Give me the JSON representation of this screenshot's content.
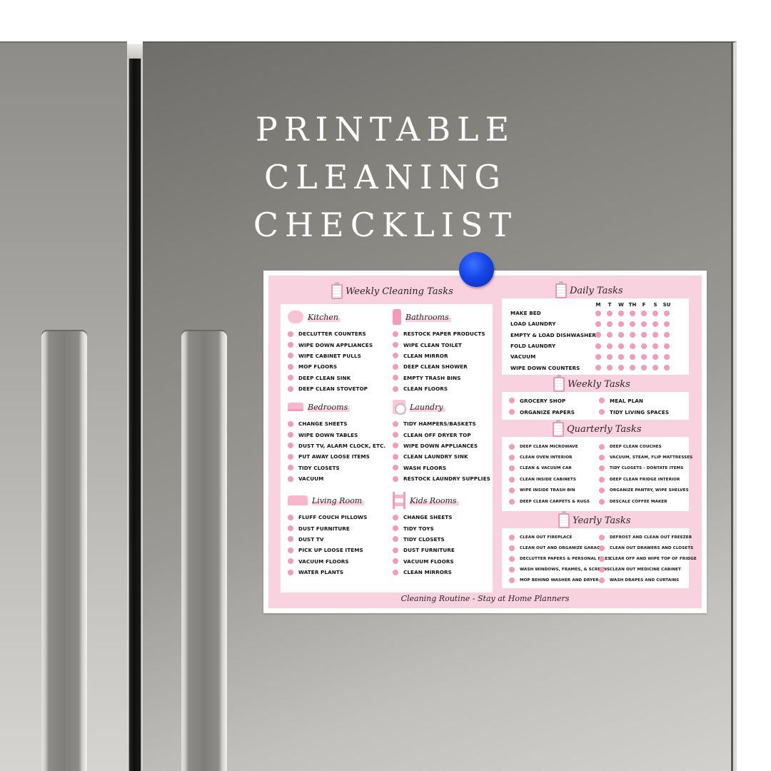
{
  "headline": {
    "lines": [
      "PRINTABLE",
      "CLEANING",
      "CHECKLIST"
    ]
  },
  "checklist": {
    "weekly_cleaning": {
      "title": "Weekly Cleaning Tasks",
      "icon": "clipboard-icon",
      "categories": [
        {
          "name": "Kitchen",
          "icon": "sponge-icon",
          "tasks": [
            "DECLUTTER COUNTERS",
            "WIPE DOWN APPLIANCES",
            "WIPE CABINET PULLS",
            "MOP FLOORS",
            "DEEP CLEAN SINK",
            "DEEP CLEAN STOVETOP"
          ]
        },
        {
          "name": "Bathrooms",
          "icon": "spray-bottle-icon",
          "tasks": [
            "RESTOCK PAPER PRODUCTS",
            "WIPE CLEAN TOILET",
            "CLEAN MIRROR",
            "DEEP CLEAN SHOWER",
            "EMPTY TRASH BINS",
            "CLEAN FLOORS"
          ]
        },
        {
          "name": "Bedrooms",
          "icon": "bed-icon",
          "tasks": [
            "CHANGE SHEETS",
            "WIPE DOWN TABLES",
            "DUST TV, ALARM CLOCK, ETC.",
            "PUT AWAY LOOSE ITEMS",
            "TIDY CLOSETS",
            "VACUUM"
          ]
        },
        {
          "name": "Laundry",
          "icon": "washing-machine-icon",
          "tasks": [
            "TIDY HAMPERS/BASKETS",
            "CLEAN OFF DRYER TOP",
            "WIPE DOWN APPLIANCES",
            "CLEAN LAUNDRY SINK",
            "WASH FLOORS",
            "RESTOCK LAUNDRY SUPPLIES"
          ]
        },
        {
          "name": "Living Room",
          "icon": "sofa-icon",
          "tasks": [
            "FLUFF COUCH PILLOWS",
            "DUST FURNITURE",
            "DUST TV",
            "PICK UP LOOSE ITEMS",
            "VACUUM FLOORS",
            "WATER PLANTS"
          ]
        },
        {
          "name": "Kids Rooms",
          "icon": "bunk-bed-icon",
          "tasks": [
            "CHANGE SHEETS",
            "TIDY TOYS",
            "TIDY CLOSETS",
            "DUST FURNITURE",
            "VACUUM FLOORS",
            "CLEAN MIRRORS"
          ]
        }
      ]
    },
    "daily": {
      "title": "Daily Tasks",
      "days": [
        "M",
        "T",
        "W",
        "TH",
        "F",
        "S",
        "SU"
      ],
      "tasks": [
        "MAKE BED",
        "LOAD LAUNDRY",
        "EMPTY & LOAD DISHWASHER",
        "FOLD LAUNDRY",
        "VACUUM",
        "WIPE DOWN COUNTERS"
      ]
    },
    "weekly": {
      "title": "Weekly Tasks",
      "tasks": [
        "GROCERY SHOP",
        "MEAL PLAN",
        "ORGANIZE PAPERS",
        "TIDY LIVING SPACES"
      ]
    },
    "quarterly": {
      "title": "Quarterly Tasks",
      "tasks": [
        "DEEP CLEAN MICROWAVE",
        "DEEP CLEAN COUCHES",
        "CLEAN OVEN INTERIOR",
        "VACUUM, STEAM, FLIP MATTRESSES",
        "CLEAN & VACUUM CAR",
        "TIDY CLOSETS - DONTATE ITEMS",
        "CLEAN INSIDE CABINETS",
        "DEEP CLEAN FRIDGE INTERIOR",
        "WIPE INSIDE TRASH BIN",
        "ORGANIZE PANTRY, WIPE SHELVES",
        "DEEP CLEAN CARPETS & RUGS",
        "DESCALE COFFEE MAKER"
      ]
    },
    "yearly": {
      "title": "Yearly Tasks",
      "tasks": [
        "CLEAN OUT FIREPLACE",
        "DEFROST AND CLEAN OUT FREEZER",
        "CLEAN OUT AND ORGANIZE GARAGE",
        "CLEAN OUT DRAWERS AND CLOSETS",
        "DECLUTTER PAPERS & PERSONAL FILES",
        "CLEAR OFF AND WIPE TOP OF FRIDGE",
        "WASH WINDOWS, FRAMES, & SCREENS",
        "CLEAN OUT MEDICINE CABINET",
        "MOP BEHIND WASHER AND DRYER",
        "WASH DRAPES AND CURTAINS"
      ]
    },
    "footer": "Cleaning Routine - Stay at Home Planners"
  },
  "colors": {
    "sheet_pink": "#f9d2df",
    "dot_pink": "#f29bbb",
    "magnet_blue": "#1646e8"
  }
}
